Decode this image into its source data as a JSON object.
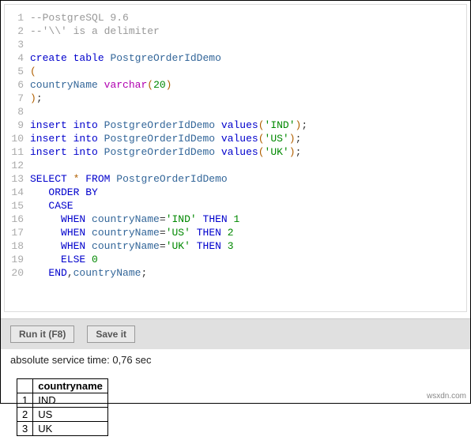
{
  "code": {
    "lines": [
      {
        "n": "1",
        "seg": [
          {
            "c": "tok-comment",
            "t": "--PostgreSQL 9.6"
          }
        ]
      },
      {
        "n": "2",
        "seg": [
          {
            "c": "tok-comment",
            "t": "--'\\\\' is a delimiter"
          }
        ]
      },
      {
        "n": "3",
        "seg": []
      },
      {
        "n": "4",
        "seg": [
          {
            "c": "tok-keyword",
            "t": "create"
          },
          {
            "c": "",
            "t": " "
          },
          {
            "c": "tok-keyword",
            "t": "table"
          },
          {
            "c": "",
            "t": " "
          },
          {
            "c": "tok-ident",
            "t": "PostgreOrderIdDemo"
          }
        ]
      },
      {
        "n": "5",
        "seg": [
          {
            "c": "tok-brace",
            "t": "("
          }
        ]
      },
      {
        "n": "6",
        "seg": [
          {
            "c": "tok-ident",
            "t": "countryName"
          },
          {
            "c": "",
            "t": " "
          },
          {
            "c": "tok-type",
            "t": "varchar"
          },
          {
            "c": "tok-brace",
            "t": "("
          },
          {
            "c": "tok-num",
            "t": "20"
          },
          {
            "c": "tok-brace",
            "t": ")"
          }
        ]
      },
      {
        "n": "7",
        "seg": [
          {
            "c": "tok-brace",
            "t": ")"
          },
          {
            "c": "tok-op",
            "t": ";"
          }
        ]
      },
      {
        "n": "8",
        "seg": []
      },
      {
        "n": "9",
        "seg": [
          {
            "c": "tok-keyword",
            "t": "insert"
          },
          {
            "c": "",
            "t": " "
          },
          {
            "c": "tok-keyword",
            "t": "into"
          },
          {
            "c": "",
            "t": " "
          },
          {
            "c": "tok-ident",
            "t": "PostgreOrderIdDemo"
          },
          {
            "c": "",
            "t": " "
          },
          {
            "c": "tok-keyword",
            "t": "values"
          },
          {
            "c": "tok-brace",
            "t": "("
          },
          {
            "c": "tok-string",
            "t": "'IND'"
          },
          {
            "c": "tok-brace",
            "t": ")"
          },
          {
            "c": "tok-op",
            "t": ";"
          }
        ]
      },
      {
        "n": "10",
        "seg": [
          {
            "c": "tok-keyword",
            "t": "insert"
          },
          {
            "c": "",
            "t": " "
          },
          {
            "c": "tok-keyword",
            "t": "into"
          },
          {
            "c": "",
            "t": " "
          },
          {
            "c": "tok-ident",
            "t": "PostgreOrderIdDemo"
          },
          {
            "c": "",
            "t": " "
          },
          {
            "c": "tok-keyword",
            "t": "values"
          },
          {
            "c": "tok-brace",
            "t": "("
          },
          {
            "c": "tok-string",
            "t": "'US'"
          },
          {
            "c": "tok-brace",
            "t": ")"
          },
          {
            "c": "tok-op",
            "t": ";"
          }
        ]
      },
      {
        "n": "11",
        "seg": [
          {
            "c": "tok-keyword",
            "t": "insert"
          },
          {
            "c": "",
            "t": " "
          },
          {
            "c": "tok-keyword",
            "t": "into"
          },
          {
            "c": "",
            "t": " "
          },
          {
            "c": "tok-ident",
            "t": "PostgreOrderIdDemo"
          },
          {
            "c": "",
            "t": " "
          },
          {
            "c": "tok-keyword",
            "t": "values"
          },
          {
            "c": "tok-brace",
            "t": "("
          },
          {
            "c": "tok-string",
            "t": "'UK'"
          },
          {
            "c": "tok-brace",
            "t": ")"
          },
          {
            "c": "tok-op",
            "t": ";"
          }
        ]
      },
      {
        "n": "12",
        "seg": []
      },
      {
        "n": "13",
        "seg": [
          {
            "c": "tok-keyword",
            "t": "SELECT"
          },
          {
            "c": "",
            "t": " "
          },
          {
            "c": "tok-star",
            "t": "*"
          },
          {
            "c": "",
            "t": " "
          },
          {
            "c": "tok-keyword",
            "t": "FROM"
          },
          {
            "c": "",
            "t": " "
          },
          {
            "c": "tok-ident",
            "t": "PostgreOrderIdDemo"
          }
        ]
      },
      {
        "n": "14",
        "seg": [
          {
            "c": "",
            "t": "   "
          },
          {
            "c": "tok-keyword",
            "t": "ORDER"
          },
          {
            "c": "",
            "t": " "
          },
          {
            "c": "tok-keyword",
            "t": "BY"
          }
        ]
      },
      {
        "n": "15",
        "seg": [
          {
            "c": "",
            "t": "   "
          },
          {
            "c": "tok-keyword",
            "t": "CASE"
          }
        ]
      },
      {
        "n": "16",
        "seg": [
          {
            "c": "",
            "t": "     "
          },
          {
            "c": "tok-keyword",
            "t": "WHEN"
          },
          {
            "c": "",
            "t": " "
          },
          {
            "c": "tok-ident",
            "t": "countryName"
          },
          {
            "c": "tok-op",
            "t": "="
          },
          {
            "c": "tok-string",
            "t": "'IND'"
          },
          {
            "c": "",
            "t": " "
          },
          {
            "c": "tok-keyword",
            "t": "THEN"
          },
          {
            "c": "",
            "t": " "
          },
          {
            "c": "tok-num",
            "t": "1"
          }
        ]
      },
      {
        "n": "17",
        "seg": [
          {
            "c": "",
            "t": "     "
          },
          {
            "c": "tok-keyword",
            "t": "WHEN"
          },
          {
            "c": "",
            "t": " "
          },
          {
            "c": "tok-ident",
            "t": "countryName"
          },
          {
            "c": "tok-op",
            "t": "="
          },
          {
            "c": "tok-string",
            "t": "'US'"
          },
          {
            "c": "",
            "t": " "
          },
          {
            "c": "tok-keyword",
            "t": "THEN"
          },
          {
            "c": "",
            "t": " "
          },
          {
            "c": "tok-num",
            "t": "2"
          }
        ]
      },
      {
        "n": "18",
        "seg": [
          {
            "c": "",
            "t": "     "
          },
          {
            "c": "tok-keyword",
            "t": "WHEN"
          },
          {
            "c": "",
            "t": " "
          },
          {
            "c": "tok-ident",
            "t": "countryName"
          },
          {
            "c": "tok-op",
            "t": "="
          },
          {
            "c": "tok-string",
            "t": "'UK'"
          },
          {
            "c": "",
            "t": " "
          },
          {
            "c": "tok-keyword",
            "t": "THEN"
          },
          {
            "c": "",
            "t": " "
          },
          {
            "c": "tok-num",
            "t": "3"
          }
        ]
      },
      {
        "n": "19",
        "seg": [
          {
            "c": "",
            "t": "     "
          },
          {
            "c": "tok-keyword",
            "t": "ELSE"
          },
          {
            "c": "",
            "t": " "
          },
          {
            "c": "tok-num",
            "t": "0"
          }
        ]
      },
      {
        "n": "20",
        "seg": [
          {
            "c": "",
            "t": "   "
          },
          {
            "c": "tok-keyword",
            "t": "END"
          },
          {
            "c": "tok-op",
            "t": ","
          },
          {
            "c": "tok-ident",
            "t": "countryName"
          },
          {
            "c": "tok-op",
            "t": ";"
          }
        ]
      }
    ]
  },
  "toolbar": {
    "run_label": "Run it (F8)",
    "save_label": "Save it"
  },
  "status": {
    "text": "absolute service time: 0,76 sec"
  },
  "result": {
    "header": "countryname",
    "rows": [
      {
        "n": "1",
        "v": "IND"
      },
      {
        "n": "2",
        "v": "US"
      },
      {
        "n": "3",
        "v": "UK"
      }
    ]
  },
  "watermark": "wsxdn.com"
}
